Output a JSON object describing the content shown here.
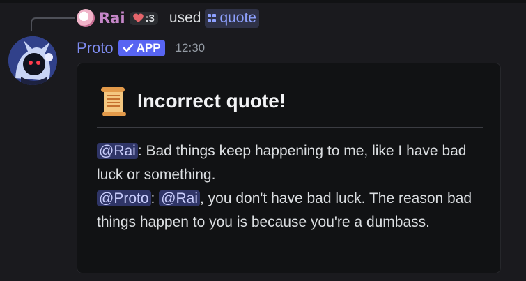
{
  "reply": {
    "user_name": "Rai",
    "tag_text": ":3",
    "used_text": "used",
    "command": "quote"
  },
  "message": {
    "author": "Proto",
    "badge": "APP",
    "timestamp": "12:30"
  },
  "embed": {
    "title": "Incorrect quote!",
    "line1_mention": "@Rai",
    "line1_text": ": Bad things keep happening to me, like I have bad luck or something.",
    "line2_mention1": "@Proto",
    "line2_sep": ": ",
    "line2_mention2": "@Rai",
    "line2_text": ", you don't have bad luck. The reason bad things happen to you is because you're a dumbass."
  },
  "colors": {
    "background": "#1a1a1e",
    "embed_bg": "#111214",
    "author": "#7f8cf1",
    "badge": "#5865f2",
    "mention_bg": "#2f3567",
    "command": "#8ea1ff"
  }
}
